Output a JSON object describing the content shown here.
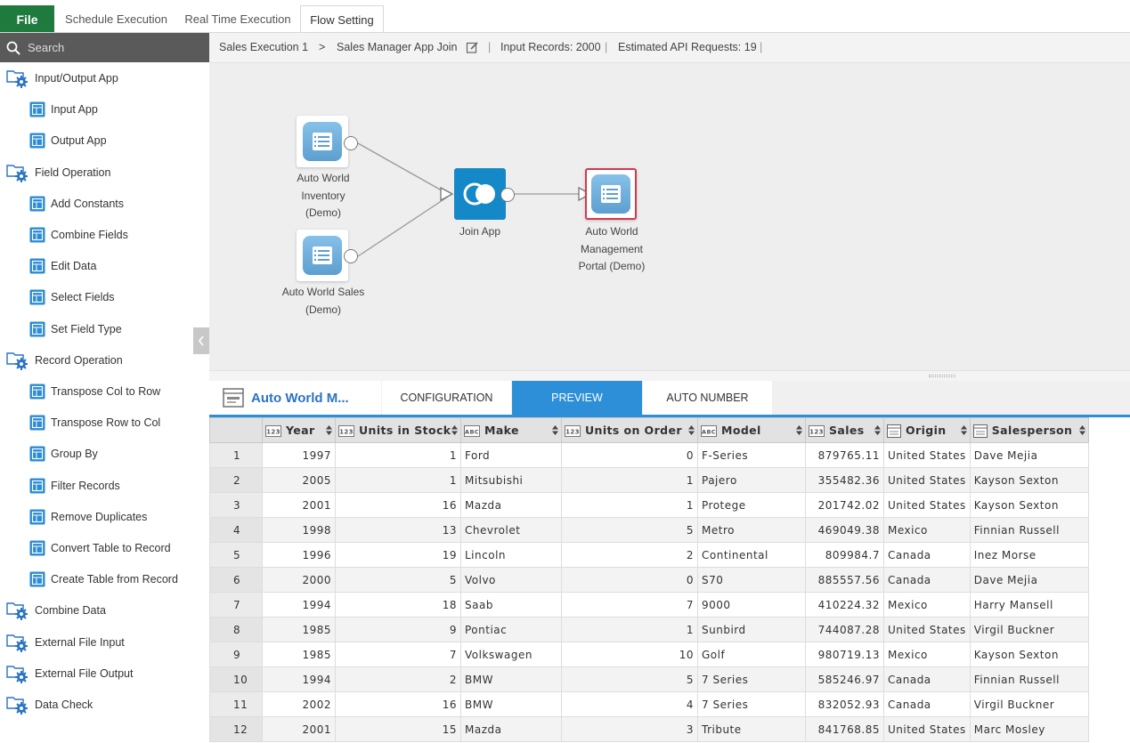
{
  "top_tabs": {
    "file": "File",
    "tabs": [
      "Schedule Execution",
      "Real Time Execution",
      "Flow Setting"
    ]
  },
  "search": {
    "placeholder": "Search"
  },
  "sidebar": {
    "items": [
      {
        "label": "Input/Output App",
        "kind": "category"
      },
      {
        "label": "Input App",
        "kind": "sub"
      },
      {
        "label": "Output App",
        "kind": "sub"
      },
      {
        "label": "Field Operation",
        "kind": "category"
      },
      {
        "label": "Add Constants",
        "kind": "sub"
      },
      {
        "label": "Combine Fields",
        "kind": "sub"
      },
      {
        "label": "Edit Data",
        "kind": "sub"
      },
      {
        "label": "Select Fields",
        "kind": "sub"
      },
      {
        "label": "Set Field Type",
        "kind": "sub"
      },
      {
        "label": "Record Operation",
        "kind": "category"
      },
      {
        "label": "Transpose Col to Row",
        "kind": "sub"
      },
      {
        "label": "Transpose Row to Col",
        "kind": "sub"
      },
      {
        "label": "Group By",
        "kind": "sub"
      },
      {
        "label": "Filter Records",
        "kind": "sub"
      },
      {
        "label": "Remove Duplicates",
        "kind": "sub"
      },
      {
        "label": "Convert Table to Record",
        "kind": "sub"
      },
      {
        "label": "Create Table from Record",
        "kind": "sub"
      },
      {
        "label": "Combine Data",
        "kind": "category"
      },
      {
        "label": "External File Input",
        "kind": "category"
      },
      {
        "label": "External File Output",
        "kind": "category"
      },
      {
        "label": "Data Check",
        "kind": "category"
      }
    ]
  },
  "breadcrumb": {
    "execution": "Sales Execution 1",
    "separator": ">",
    "app": "Sales Manager App Join",
    "input_records": "Input Records: 2000",
    "api_requests": "Estimated API Requests: 19",
    "divider": "|"
  },
  "flow": {
    "nodes": {
      "inventory": "Auto World\nInventory\n(Demo)",
      "sales": "Auto World Sales\n(Demo)",
      "join": "Join App",
      "portal": "Auto World\nManagement\nPortal (Demo)"
    }
  },
  "panel": {
    "title": "Auto World M...",
    "tabs": [
      "CONFIGURATION",
      "PREVIEW",
      "AUTO NUMBER"
    ],
    "active_tab": "PREVIEW"
  },
  "table": {
    "columns": [
      {
        "name": "Year",
        "type": "number"
      },
      {
        "name": "Units in Stock",
        "type": "number"
      },
      {
        "name": "Make",
        "type": "text"
      },
      {
        "name": "Units on Order",
        "type": "number"
      },
      {
        "name": "Model",
        "type": "text"
      },
      {
        "name": "Sales",
        "type": "number"
      },
      {
        "name": "Origin",
        "type": "list"
      },
      {
        "name": "Salesperson",
        "type": "list"
      }
    ],
    "rows": [
      [
        "1",
        "1997",
        "1",
        "Ford",
        "0",
        "F-Series",
        "879765.11",
        "United States",
        "Dave Mejia"
      ],
      [
        "2",
        "2005",
        "1",
        "Mitsubishi",
        "1",
        "Pajero",
        "355482.36",
        "United States",
        "Kayson Sexton"
      ],
      [
        "3",
        "2001",
        "16",
        "Mazda",
        "1",
        "Protege",
        "201742.02",
        "United States",
        "Kayson Sexton"
      ],
      [
        "4",
        "1998",
        "13",
        "Chevrolet",
        "5",
        "Metro",
        "469049.38",
        "Mexico",
        "Finnian Russell"
      ],
      [
        "5",
        "1996",
        "19",
        "Lincoln",
        "2",
        "Continental",
        "809984.7",
        "Canada",
        "Inez Morse"
      ],
      [
        "6",
        "2000",
        "5",
        "Volvo",
        "0",
        "S70",
        "885557.56",
        "Canada",
        "Dave Mejia"
      ],
      [
        "7",
        "1994",
        "18",
        "Saab",
        "7",
        "9000",
        "410224.32",
        "Mexico",
        "Harry Mansell"
      ],
      [
        "8",
        "1985",
        "9",
        "Pontiac",
        "1",
        "Sunbird",
        "744087.28",
        "United States",
        "Virgil Buckner"
      ],
      [
        "9",
        "1985",
        "7",
        "Volkswagen",
        "10",
        "Golf",
        "980719.13",
        "Mexico",
        "Kayson Sexton"
      ],
      [
        "10",
        "1994",
        "2",
        "BMW",
        "5",
        "7 Series",
        "585246.97",
        "Canada",
        "Finnian Russell"
      ],
      [
        "11",
        "2002",
        "16",
        "BMW",
        "4",
        "7 Series",
        "832052.93",
        "Canada",
        "Virgil Buckner"
      ],
      [
        "12",
        "2001",
        "15",
        "Mazda",
        "3",
        "Tribute",
        "841768.85",
        "United States",
        "Marc Mosley"
      ]
    ]
  },
  "colors": {
    "file_green": "#1e7a3d",
    "accent_blue": "#2d8fd7",
    "title_blue": "#2b73c4",
    "join_blue": "#1588c8",
    "selected_red": "#d2394d"
  }
}
